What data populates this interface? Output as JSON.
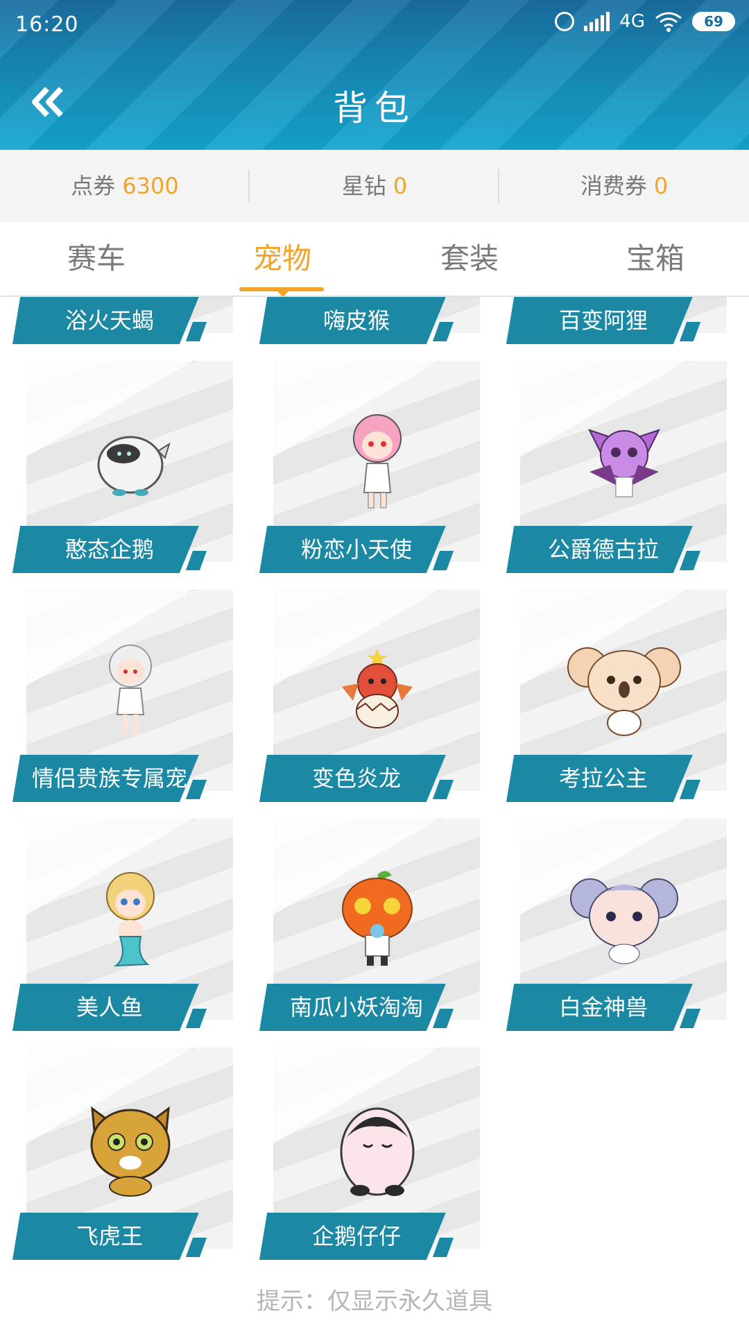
{
  "status_bar": {
    "time": "16:20",
    "network": "4G",
    "battery": "69"
  },
  "header": {
    "back_icon": "double-chevron-left-icon",
    "title": "背包"
  },
  "currency": [
    {
      "label": "点券",
      "value": "6300"
    },
    {
      "label": "星钻",
      "value": "0"
    },
    {
      "label": "消费券",
      "value": "0"
    }
  ],
  "tabs": [
    {
      "label": "赛车",
      "active": false
    },
    {
      "label": "宠物",
      "active": true
    },
    {
      "label": "套装",
      "active": false
    },
    {
      "label": "宝箱",
      "active": false
    }
  ],
  "pets": [
    {
      "name": "浴火天蝎",
      "icon": "scorpion-pet-icon"
    },
    {
      "name": "嗨皮猴",
      "icon": "monkey-pet-icon"
    },
    {
      "name": "百变阿狸",
      "icon": "fox-pet-icon"
    },
    {
      "name": "憨态企鹅",
      "icon": "penguin-pet-icon"
    },
    {
      "name": "粉恋小天使",
      "icon": "angel-pet-icon"
    },
    {
      "name": "公爵德古拉",
      "icon": "bat-pet-icon"
    },
    {
      "name": "情侣贵族专属宠",
      "icon": "noble-girl-pet-icon"
    },
    {
      "name": "变色炎龙",
      "icon": "dragon-pet-icon"
    },
    {
      "name": "考拉公主",
      "icon": "koala-pet-icon"
    },
    {
      "name": "美人鱼",
      "icon": "mermaid-pet-icon"
    },
    {
      "name": "南瓜小妖淘淘",
      "icon": "pumpkin-pet-icon"
    },
    {
      "name": "白金神兽",
      "icon": "mouse-pet-icon"
    },
    {
      "name": "飞虎王",
      "icon": "tiger-pet-icon"
    },
    {
      "name": "企鹅仔仔",
      "icon": "baby-penguin-pet-icon"
    }
  ],
  "hint": "提示：仅显示永久道具",
  "colors": {
    "header": "#1789b7",
    "accent": "#f2a42a",
    "label_bg": "#1b88a4"
  }
}
